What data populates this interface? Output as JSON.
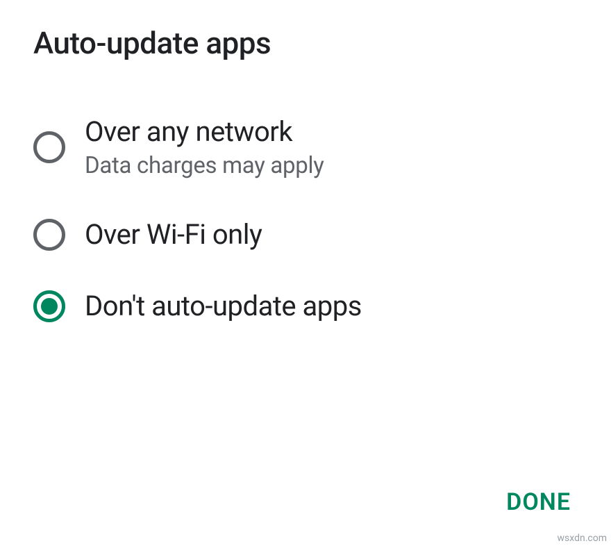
{
  "dialog": {
    "title": "Auto-update apps",
    "options": [
      {
        "label": "Over any network",
        "sublabel": "Data charges may apply",
        "selected": false
      },
      {
        "label": "Over Wi-Fi only",
        "sublabel": "",
        "selected": false
      },
      {
        "label": "Don't auto-update apps",
        "sublabel": "",
        "selected": true
      }
    ],
    "done_label": "DONE"
  },
  "watermark": "wsxdn.com"
}
